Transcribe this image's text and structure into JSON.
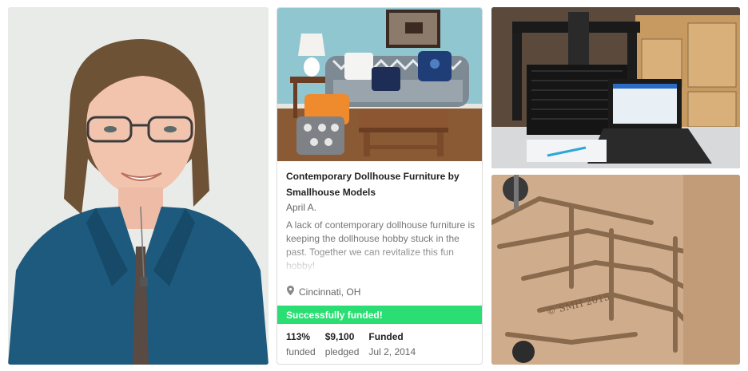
{
  "project": {
    "title": "Contemporary Dollhouse Furniture by Smallhouse Models",
    "author": "April A.",
    "blurb": "A lack of contemporary dollhouse furniture is keeping the dollhouse hobby stuck in the past. Together we can revitalize this fun hobby!",
    "location": "Cincinnati, OH",
    "status": "Successfully funded!",
    "stats": [
      {
        "value": "113%",
        "label": "funded"
      },
      {
        "value": "$9,100",
        "label": "pledged"
      },
      {
        "value": "Funded",
        "label": "Jul 2, 2014"
      }
    ]
  },
  "engraving": {
    "text": "© SMH 2015"
  },
  "colors": {
    "funded_green": "#2bde73",
    "sofa_blue": "#1f3e78",
    "wall_blue": "#8fc6d0"
  },
  "icons": {
    "location": "map-pin-icon"
  }
}
